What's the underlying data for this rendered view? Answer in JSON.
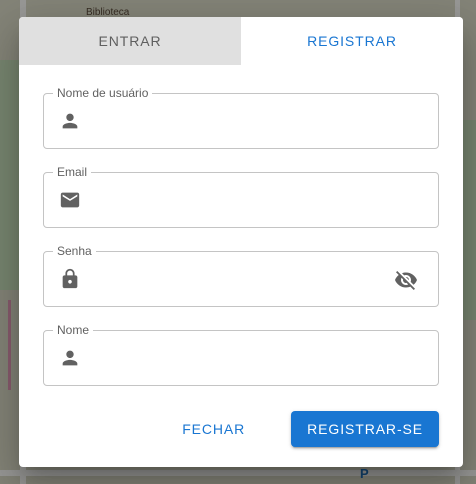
{
  "map": {
    "label_library": "Biblioteca",
    "parking_letter": "P"
  },
  "tabs": [
    {
      "label": "ENTRAR",
      "active": false
    },
    {
      "label": "REGISTRAR",
      "active": true
    }
  ],
  "form": {
    "username": {
      "label": "Nome de usuário",
      "value": "",
      "icon": "person-icon"
    },
    "email": {
      "label": "Email",
      "value": "",
      "icon": "mail-icon"
    },
    "password": {
      "label": "Senha",
      "value": "",
      "icon": "lock-icon",
      "toggle_icon": "visibility-off-icon"
    },
    "name": {
      "label": "Nome",
      "value": "",
      "icon": "person-icon"
    }
  },
  "actions": {
    "close_label": "FECHAR",
    "submit_label": "REGISTRAR-SE"
  },
  "colors": {
    "accent": "#1976d2",
    "tab_inactive_bg": "#e0e0e0",
    "icon": "#616161"
  }
}
